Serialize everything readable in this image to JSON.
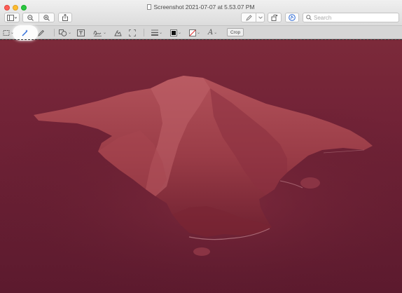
{
  "window": {
    "title": "Screenshot 2021-07-07 at 5.53.07 PM"
  },
  "toolbar": {
    "search_placeholder": "Search",
    "crop_label": "Crop"
  },
  "colors": {
    "tint_overlay": "#7a1426",
    "sea": "#5a1a2c",
    "island_light": "#b84a52",
    "island_dark": "#6f1d2a",
    "traffic_close": "#fe5f57",
    "traffic_min": "#febc2e",
    "traffic_max": "#28c840"
  },
  "icons": [
    "sidebar-icon",
    "zoom-out-icon",
    "zoom-in-icon",
    "share-icon",
    "pen-icon",
    "rotate-icon",
    "markup-icon",
    "search-icon",
    "rectangular-selection-icon",
    "instant-alpha-icon",
    "sketch-icon",
    "shapes-icon",
    "text-icon",
    "sign-icon",
    "adjust-color-icon",
    "adjust-size-icon",
    "shape-style-icon",
    "border-color-icon",
    "fill-color-icon",
    "text-style-icon"
  ]
}
